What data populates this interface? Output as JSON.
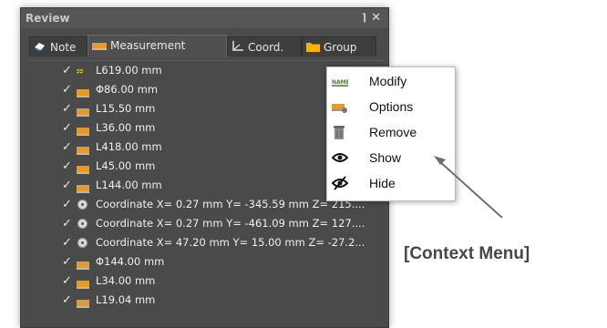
{
  "panel": {
    "title": "Review",
    "pin_glyph": "⌉",
    "close_glyph": "✕",
    "tabs": [
      {
        "label": "Note",
        "icon": "note-icon"
      },
      {
        "label": "Measurement",
        "icon": "ruler-icon",
        "active": true
      },
      {
        "label": "Coord.",
        "icon": "axis-icon"
      },
      {
        "label": "Group",
        "icon": "folder-icon"
      }
    ]
  },
  "rows": [
    {
      "text": "L619.00 mm",
      "icon": "pin-arrows-icon"
    },
    {
      "text": "Φ86.00 mm",
      "icon": "ruler-icon"
    },
    {
      "text": "L15.50 mm",
      "icon": "ruler-icon"
    },
    {
      "text": "L36.00 mm",
      "icon": "ruler-icon"
    },
    {
      "text": "L418.00 mm",
      "icon": "ruler-icon"
    },
    {
      "text": "L45.00 mm",
      "icon": "ruler-icon"
    },
    {
      "text": "L144.00 mm",
      "icon": "ruler-icon"
    },
    {
      "text": "Coordinate  X= 0.27 mm  Y= -345.59 mm  Z= 215....",
      "icon": "coordinate-icon"
    },
    {
      "text": "Coordinate  X= 0.27 mm  Y= -461.09 mm  Z= 127....",
      "icon": "coordinate-icon"
    },
    {
      "text": "Coordinate  X= 47.20 mm  Y= 15.00 mm  Z= -27.2...",
      "icon": "coordinate-icon"
    },
    {
      "text": "Φ144.00 mm",
      "icon": "ruler-icon"
    },
    {
      "text": "L34.00 mm",
      "icon": "ruler-icon"
    },
    {
      "text": "L19.04 mm",
      "icon": "ruler-icon"
    }
  ],
  "check_glyph": "✓",
  "context_menu": {
    "items": [
      {
        "label": "Modify",
        "icon": "rename-icon"
      },
      {
        "label": "Options",
        "icon": "options-icon"
      },
      {
        "label": "Remove",
        "icon": "trash-icon"
      },
      {
        "label": "Show",
        "icon": "eye-icon"
      },
      {
        "label": "Hide",
        "icon": "eye-hidden-icon"
      }
    ]
  },
  "annotation": {
    "label": "[Context Menu]"
  },
  "colors": {
    "panel_bg": "#4b4b4b",
    "ruler": "#e49b2d",
    "pin_arrows": "#f2d400",
    "annotation_text": "#474747"
  }
}
